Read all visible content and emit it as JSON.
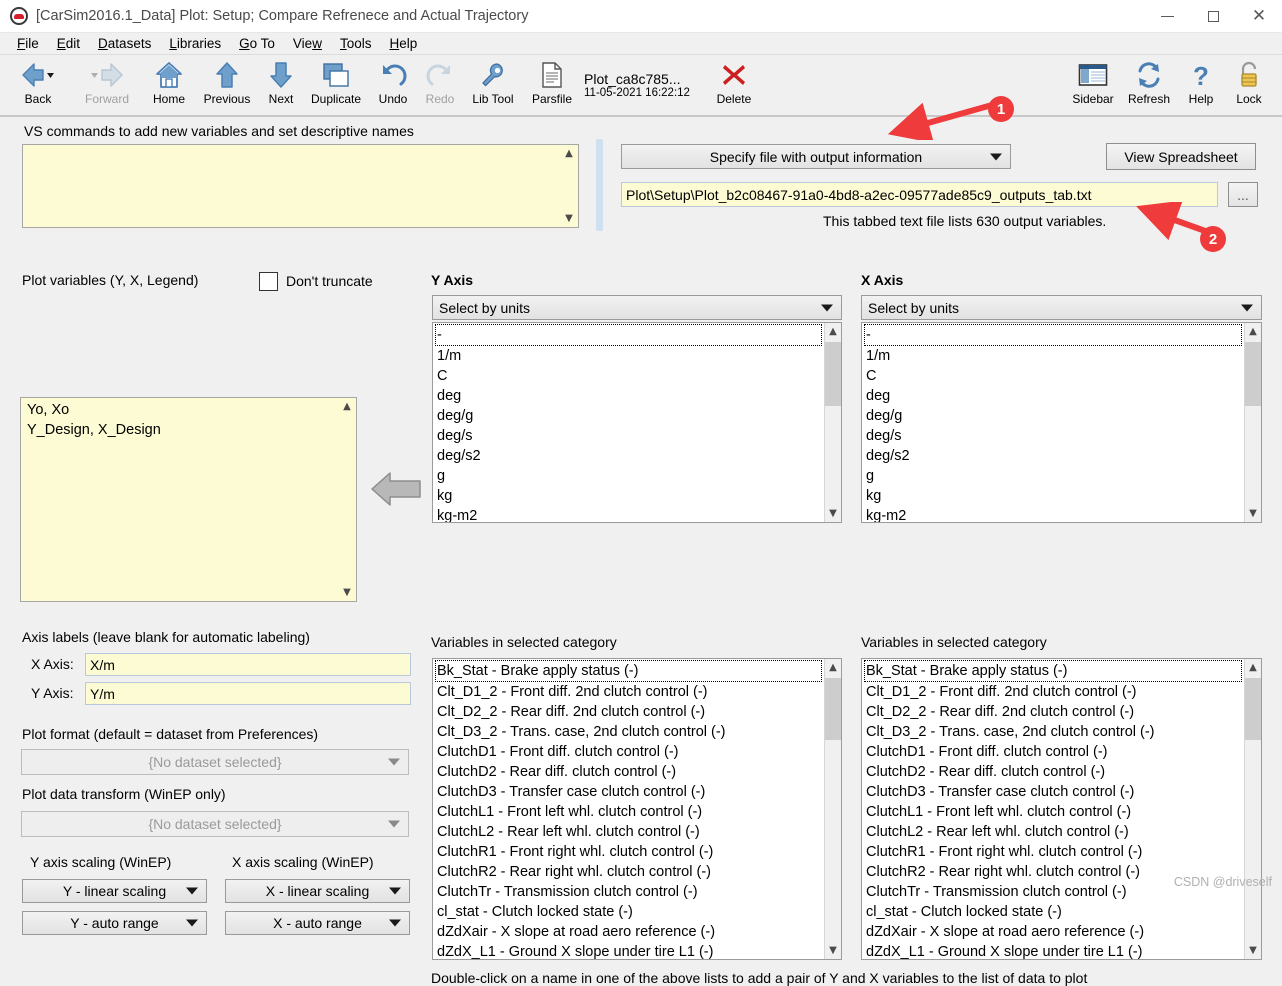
{
  "window": {
    "title": "[CarSim2016.1_Data] Plot: Setup; Compare Refrenece and Actual Trajectory",
    "app_icon": "carsim-icon",
    "minimize": "minimize-icon",
    "maximize": "maximize-icon",
    "close": "close-icon"
  },
  "menu": [
    {
      "label": "File",
      "accel": "F"
    },
    {
      "label": "Edit",
      "accel": "E"
    },
    {
      "label": "Datasets",
      "accel": "D"
    },
    {
      "label": "Libraries",
      "accel": "L"
    },
    {
      "label": "Go To",
      "accel": "G"
    },
    {
      "label": "View",
      "accel": "w"
    },
    {
      "label": "Tools",
      "accel": "T"
    },
    {
      "label": "Help",
      "accel": "H"
    }
  ],
  "toolbar": {
    "left": [
      {
        "label": "Back",
        "icon": "back-arrow-icon",
        "disabled": false,
        "dropdown": true
      },
      {
        "label": "Forward",
        "icon": "forward-arrow-icon",
        "disabled": true,
        "dropdown": true
      },
      {
        "label": "Home",
        "icon": "home-icon",
        "disabled": false
      },
      {
        "label": "Previous",
        "icon": "up-arrow-icon",
        "disabled": false
      },
      {
        "label": "Next",
        "icon": "down-arrow-icon",
        "disabled": false
      },
      {
        "label": "Duplicate",
        "icon": "duplicate-icon",
        "disabled": false
      },
      {
        "label": "Undo",
        "icon": "undo-icon",
        "disabled": false
      },
      {
        "label": "Redo",
        "icon": "redo-icon",
        "disabled": true
      },
      {
        "label": "Lib Tool",
        "icon": "wrench-icon",
        "disabled": false
      },
      {
        "label": "Parsfile",
        "icon": "document-icon",
        "disabled": false
      }
    ],
    "parsfile": {
      "name": "Plot_ca8c785...",
      "timestamp": "11-05-2021 16:22:12"
    },
    "delete": {
      "label": "Delete",
      "icon": "red-x-icon"
    },
    "right": [
      {
        "label": "Sidebar",
        "icon": "sidebar-icon"
      },
      {
        "label": "Refresh",
        "icon": "refresh-icon"
      },
      {
        "label": "Help",
        "icon": "question-mark-icon"
      },
      {
        "label": "Lock",
        "icon": "padlock-icon"
      }
    ]
  },
  "vs_commands": {
    "label": "VS commands to add new variables and set descriptive names",
    "value": ""
  },
  "output_info": {
    "dropdown_label": "Specify file with output information",
    "view_spreadsheet_label": "View  Spreadsheet",
    "file_path": "Plot\\Setup\\Plot_b2c08467-91a0-4bd8-a2ec-09577ade85c9_outputs_tab.txt",
    "browse_label": "...",
    "note": "This tabbed text file lists 630 output variables.",
    "variable_count": 630
  },
  "plot_variables": {
    "label": "Plot variables  (Y, X, Legend)",
    "dont_truncate_label": "Don't truncate",
    "dont_truncate_checked": false,
    "items": [
      "Yo, Xo",
      "Y_Design, X_Design"
    ],
    "transfer_arrow": "left-arrow-icon"
  },
  "axis_labels": {
    "section_label": "Axis labels (leave blank for automatic labeling)",
    "x_label": "X Axis:",
    "x_value": "X/m",
    "y_label": "Y Axis:",
    "y_value": "Y/m"
  },
  "plot_format": {
    "label": "Plot format (default = dataset from Preferences)",
    "value": "{No dataset selected}"
  },
  "plot_transform": {
    "label": "Plot data transform (WinEP only)",
    "value": "{No dataset selected}"
  },
  "scaling": {
    "y_label": "Y axis scaling (WinEP)",
    "x_label": "X axis scaling (WinEP)",
    "y_scaling": "Y - linear scaling",
    "y_range": "Y - auto range",
    "x_scaling": "X - linear scaling",
    "x_range": "X - auto range"
  },
  "y_axis": {
    "title": "Y Axis",
    "select_by": "Select by units",
    "units": [
      "-",
      "1/m",
      "C",
      "deg",
      "deg/g",
      "deg/s",
      "deg/s2",
      "g",
      "kg",
      "kg-m2"
    ],
    "selected_unit": "-",
    "vars_label": "Variables in selected category",
    "variables": [
      "Bk_Stat - Brake apply status (-)",
      "Clt_D1_2 - Front diff. 2nd clutch control (-)",
      "Clt_D2_2 - Rear diff. 2nd clutch control (-)",
      "Clt_D3_2 - Trans. case, 2nd clutch control (-)",
      "ClutchD1 - Front diff. clutch control (-)",
      "ClutchD2 - Rear diff. clutch control (-)",
      "ClutchD3 - Transfer case clutch control (-)",
      "ClutchL1 - Front left whl. clutch control (-)",
      "ClutchL2 - Rear left whl. clutch control (-)",
      "ClutchR1 - Front right whl. clutch control (-)",
      "ClutchR2 - Rear right whl. clutch control (-)",
      "ClutchTr - Transmission clutch control (-)",
      "cl_stat - Clutch locked state (-)",
      "dZdXair - X slope at road aero reference (-)",
      "dZdX_L1 - Ground X slope under tire L1 (-)"
    ],
    "selected_variable": "Bk_Stat - Brake apply status (-)"
  },
  "x_axis": {
    "title": "X Axis",
    "select_by": "Select by units",
    "units": [
      "-",
      "1/m",
      "C",
      "deg",
      "deg/g",
      "deg/s",
      "deg/s2",
      "g",
      "kg",
      "kg-m2"
    ],
    "selected_unit": "-",
    "vars_label": "Variables in selected category",
    "variables": [
      "Bk_Stat - Brake apply status (-)",
      "Clt_D1_2 - Front diff. 2nd clutch control (-)",
      "Clt_D2_2 - Rear diff. 2nd clutch control (-)",
      "Clt_D3_2 - Trans. case, 2nd clutch control (-)",
      "ClutchD1 - Front diff. clutch control (-)",
      "ClutchD2 - Rear diff. clutch control (-)",
      "ClutchD3 - Transfer case clutch control (-)",
      "ClutchL1 - Front left whl. clutch control (-)",
      "ClutchL2 - Rear left whl. clutch control (-)",
      "ClutchR1 - Front right whl. clutch control (-)",
      "ClutchR2 - Rear right whl. clutch control (-)",
      "ClutchTr - Transmission clutch control (-)",
      "cl_stat - Clutch locked state (-)",
      "dZdXair - X slope at road aero reference (-)",
      "dZdX_L1 - Ground X slope under tire L1 (-)"
    ],
    "selected_variable": "Bk_Stat - Brake apply status (-)"
  },
  "footer": {
    "hint": "Double-click on a name in one of the above lists to add a pair of Y and X variables to the list of  data to plot",
    "watermark": "CSDN @driveself"
  },
  "annotations": [
    {
      "number": "1",
      "color": "#ef3b3b"
    },
    {
      "number": "2",
      "color": "#ef3b3b"
    }
  ],
  "colors": {
    "window_bg": "#f0f0f0",
    "field_yellow": "#fdfbd3",
    "annotation_red": "#ef3b3b",
    "icon_blue": "#4a7fb5"
  }
}
